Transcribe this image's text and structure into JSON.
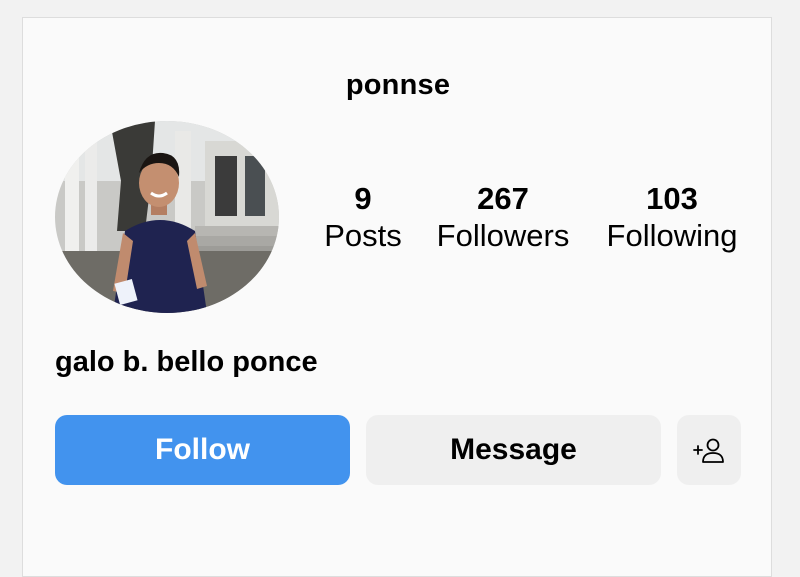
{
  "profile": {
    "username": "ponnse",
    "full_name": "galo b. bello ponce",
    "avatar_alt": "profile picture"
  },
  "stats": {
    "posts": {
      "count": "9",
      "label": "Posts"
    },
    "followers": {
      "count": "267",
      "label": "Followers"
    },
    "following": {
      "count": "103",
      "label": "Following"
    }
  },
  "actions": {
    "follow_label": "Follow",
    "message_label": "Message",
    "add_user_icon": "person-add-icon"
  },
  "colors": {
    "follow_button": "#4293ee",
    "secondary_button": "#efefef",
    "card_background": "#fafafa"
  }
}
